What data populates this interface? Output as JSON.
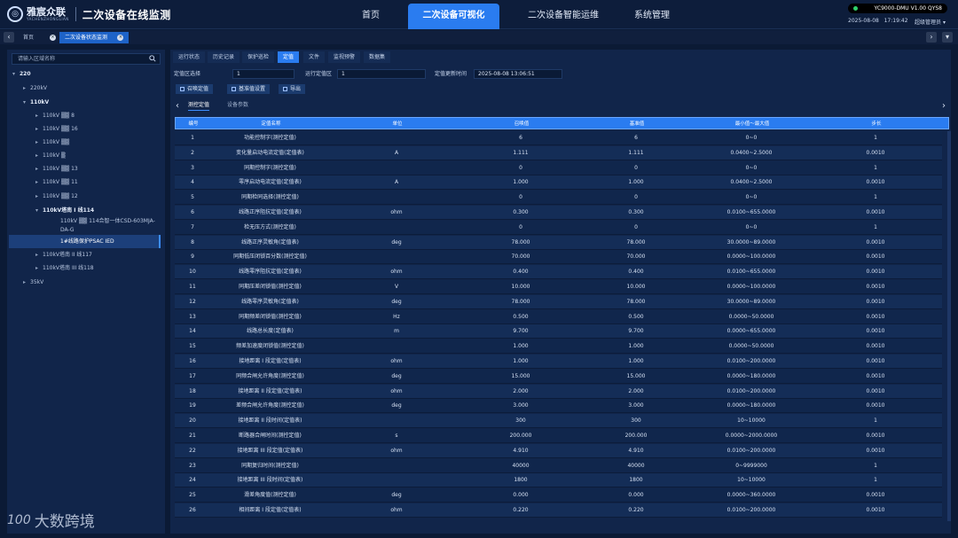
{
  "header": {
    "brand": "雅宸众联",
    "brand_en": "YACHENZHONGLIAN",
    "app_title": "二次设备在线监测",
    "nav": [
      "首页",
      "二次设备可视化",
      "二次设备智能运维",
      "系统管理"
    ],
    "active_nav": "二次设备可视化",
    "version": "YC9000-DMU V1.00 QYS8",
    "date": "2025-08-08",
    "time": "17:19:42",
    "user": "超级管理员"
  },
  "tabbar": {
    "tabs": [
      "首页",
      "二次设备状态监测"
    ],
    "active": "二次设备状态监测"
  },
  "sidebar": {
    "search_placeholder": "请输入区域名称",
    "tree": [
      {
        "label": "220",
        "level": 0,
        "toggle": "▾",
        "bold": true
      },
      {
        "label": "220kV",
        "level": 1,
        "toggle": "▸"
      },
      {
        "label": "110kV",
        "level": 1,
        "toggle": "▾",
        "bold": true
      },
      {
        "label": "110kV ▒▒ 8",
        "level": 2,
        "toggle": "▸"
      },
      {
        "label": "110kV ▒▒ 16",
        "level": 2,
        "toggle": "▸"
      },
      {
        "label": "110kV ▒▒",
        "level": 2,
        "toggle": "▸"
      },
      {
        "label": "110kV ▒",
        "level": 2,
        "toggle": "▸"
      },
      {
        "label": "110kV ▒▒ 13",
        "level": 2,
        "toggle": "▸"
      },
      {
        "label": "110kV ▒▒ 11",
        "level": 2,
        "toggle": "▸"
      },
      {
        "label": "110kV ▒▒ 12",
        "level": 2,
        "toggle": "▸"
      },
      {
        "label": "110kV塔南 I 线114",
        "level": 2,
        "toggle": "▾",
        "bold": true
      },
      {
        "label": "110kV ▒▒ 114合智一体CSD-603MJA-",
        "level": 3,
        "toggle": ""
      },
      {
        "label": "DA-G",
        "level": 3,
        "toggle": ""
      },
      {
        "label": "1#线路保护PSAC IED",
        "level": 3,
        "toggle": "",
        "selected": true
      },
      {
        "label": "110kV塔南 II 线117",
        "level": 2,
        "toggle": "▸"
      },
      {
        "label": "110kV塔南 III 线118",
        "level": 2,
        "toggle": "▸"
      },
      {
        "label": "35kV",
        "level": 1,
        "toggle": "▸"
      }
    ]
  },
  "main": {
    "tabs": [
      "运行状态",
      "历史记录",
      "保护巡检",
      "定值",
      "文件",
      "监视预警",
      "数据集"
    ],
    "active_tab": "定值",
    "filters": {
      "zone_label": "定值区选择",
      "zone_value": "1",
      "run_zone_label": "运行定值区",
      "run_zone_value": "1",
      "update_label": "定值更新时间",
      "update_value": "2025-08-08 13:06:51"
    },
    "actions": [
      "召唤定值",
      "基准值设置",
      "导出"
    ],
    "subtabs": [
      "测控定值",
      "设备参数"
    ],
    "active_subtab": "测控定值",
    "columns": [
      "编号",
      "定值名称",
      "单位",
      "召唤值",
      "基准值",
      "最小值～最大值",
      "步长"
    ],
    "rows": [
      [
        "1",
        "功能控制字(测控定值)",
        "",
        "6",
        "6",
        "0~0",
        "1"
      ],
      [
        "2",
        "变化量启动电流定值(定值表)",
        "A",
        "1.111",
        "1.111",
        "0.0400~2.5000",
        "0.0010"
      ],
      [
        "3",
        "同期控制字(测控定值)",
        "",
        "0",
        "0",
        "0~0",
        "1"
      ],
      [
        "4",
        "零序启动电流定值(定值表)",
        "A",
        "1.000",
        "1.000",
        "0.0400~2.5000",
        "0.0010"
      ],
      [
        "5",
        "同期检同选择(测控定值)",
        "",
        "0",
        "0",
        "0~0",
        "1"
      ],
      [
        "6",
        "线路正序阻抗定值(定值表)",
        "ohm",
        "0.300",
        "0.300",
        "0.0100~655.0000",
        "0.0010"
      ],
      [
        "7",
        "检无压方式(测控定值)",
        "",
        "0",
        "0",
        "0~0",
        "1"
      ],
      [
        "8",
        "线路正序灵敏角(定值表)",
        "deg",
        "78.000",
        "78.000",
        "30.0000~89.0000",
        "0.0010"
      ],
      [
        "9",
        "同期低压闭锁百分数(测控定值)",
        "",
        "70.000",
        "70.000",
        "0.0000~100.0000",
        "0.0010"
      ],
      [
        "10",
        "线路零序阻抗定值(定值表)",
        "ohm",
        "0.400",
        "0.400",
        "0.0100~655.0000",
        "0.0010"
      ],
      [
        "11",
        "同期压差闭锁值(测控定值)",
        "V",
        "10.000",
        "10.000",
        "0.0000~100.0000",
        "0.0010"
      ],
      [
        "12",
        "线路零序灵敏角(定值表)",
        "deg",
        "78.000",
        "78.000",
        "30.0000~89.0000",
        "0.0010"
      ],
      [
        "13",
        "同期频差闭锁值(测控定值)",
        "Hz",
        "0.500",
        "0.500",
        "0.0000~50.0000",
        "0.0010"
      ],
      [
        "14",
        "线路总长度(定值表)",
        "m",
        "9.700",
        "9.700",
        "0.0000~655.0000",
        "0.0010"
      ],
      [
        "15",
        "频差加速度闭锁值(测控定值)",
        "",
        "1.000",
        "1.000",
        "0.0000~50.0000",
        "0.0010"
      ],
      [
        "16",
        "接地距离 I 段定值(定值表)",
        "ohm",
        "1.000",
        "1.000",
        "0.0100~200.0000",
        "0.0010"
      ],
      [
        "17",
        "同频合闸允许角度(测控定值)",
        "deg",
        "15.000",
        "15.000",
        "0.0000~180.0000",
        "0.0010"
      ],
      [
        "18",
        "接地距离 II 段定值(定值表)",
        "ohm",
        "2.000",
        "2.000",
        "0.0100~200.0000",
        "0.0010"
      ],
      [
        "19",
        "差频合闸允许角度(测控定值)",
        "deg",
        "3.000",
        "3.000",
        "0.0000~180.0000",
        "0.0010"
      ],
      [
        "20",
        "接地距离 II 段时间(定值表)",
        "",
        "300",
        "300",
        "10~10000",
        "1"
      ],
      [
        "21",
        "断路器合闸时间(测控定值)",
        "s",
        "200.000",
        "200.000",
        "0.0000~2000.0000",
        "0.0010"
      ],
      [
        "22",
        "接地距离 III 段定值(定值表)",
        "ohm",
        "4.910",
        "4.910",
        "0.0100~200.0000",
        "0.0010"
      ],
      [
        "23",
        "同期复归时间(测控定值)",
        "",
        "40000",
        "40000",
        "0~9999000",
        "1"
      ],
      [
        "24",
        "接地距离 III 段时间(定值表)",
        "",
        "1800",
        "1800",
        "10~10000",
        "1"
      ],
      [
        "25",
        "滑差角度值(测控定值)",
        "deg",
        "0.000",
        "0.000",
        "0.0000~360.0000",
        "0.0010"
      ],
      [
        "26",
        "相间距离 I 段定值(定值表)",
        "ohm",
        "0.220",
        "0.220",
        "0.0100~200.0000",
        "0.0010"
      ]
    ]
  },
  "watermark": "大数跨境",
  "watermark_logo": "100"
}
